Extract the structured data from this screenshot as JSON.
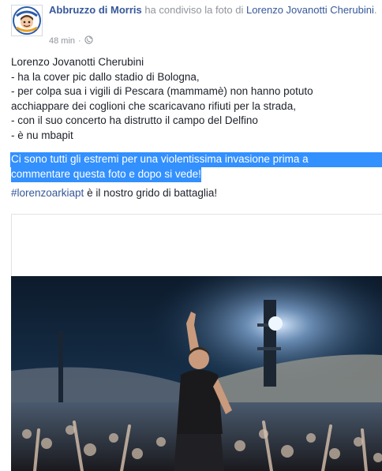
{
  "header": {
    "page_name": "Abbruzzo di Morris",
    "shared_text": " ha condiviso la foto di ",
    "user_name": "Lorenzo Jovanotti Cherubini",
    "after_user": ".",
    "time": "48 min",
    "separator": "·",
    "privacy_icon": "globe-icon"
  },
  "message": {
    "lines": [
      "Lorenzo Jovanotti Cherubini",
      "- ha la cover pic dallo stadio di Bologna,",
      "- per colpa sua i vigili di Pescara (mammamè) non hanno potuto",
      "acchiappare dei coglioni che scaricavano rifiuti per la strada,",
      "- con il suo concerto ha distrutto il campo del Delfino",
      "- è nu mbapit"
    ],
    "highlighted_lines": [
      "Ci sono tutti gli estremi per una violentissima invasione prima a",
      "commentare questa foto e dopo si vede!"
    ],
    "hashtag": "#lorenzoarkiapt",
    "hashtag_rest": " è il nostro grido di battaglia!"
  },
  "colors": {
    "link": "#365899",
    "meta": "#90949c",
    "selection": "#3390ff"
  }
}
